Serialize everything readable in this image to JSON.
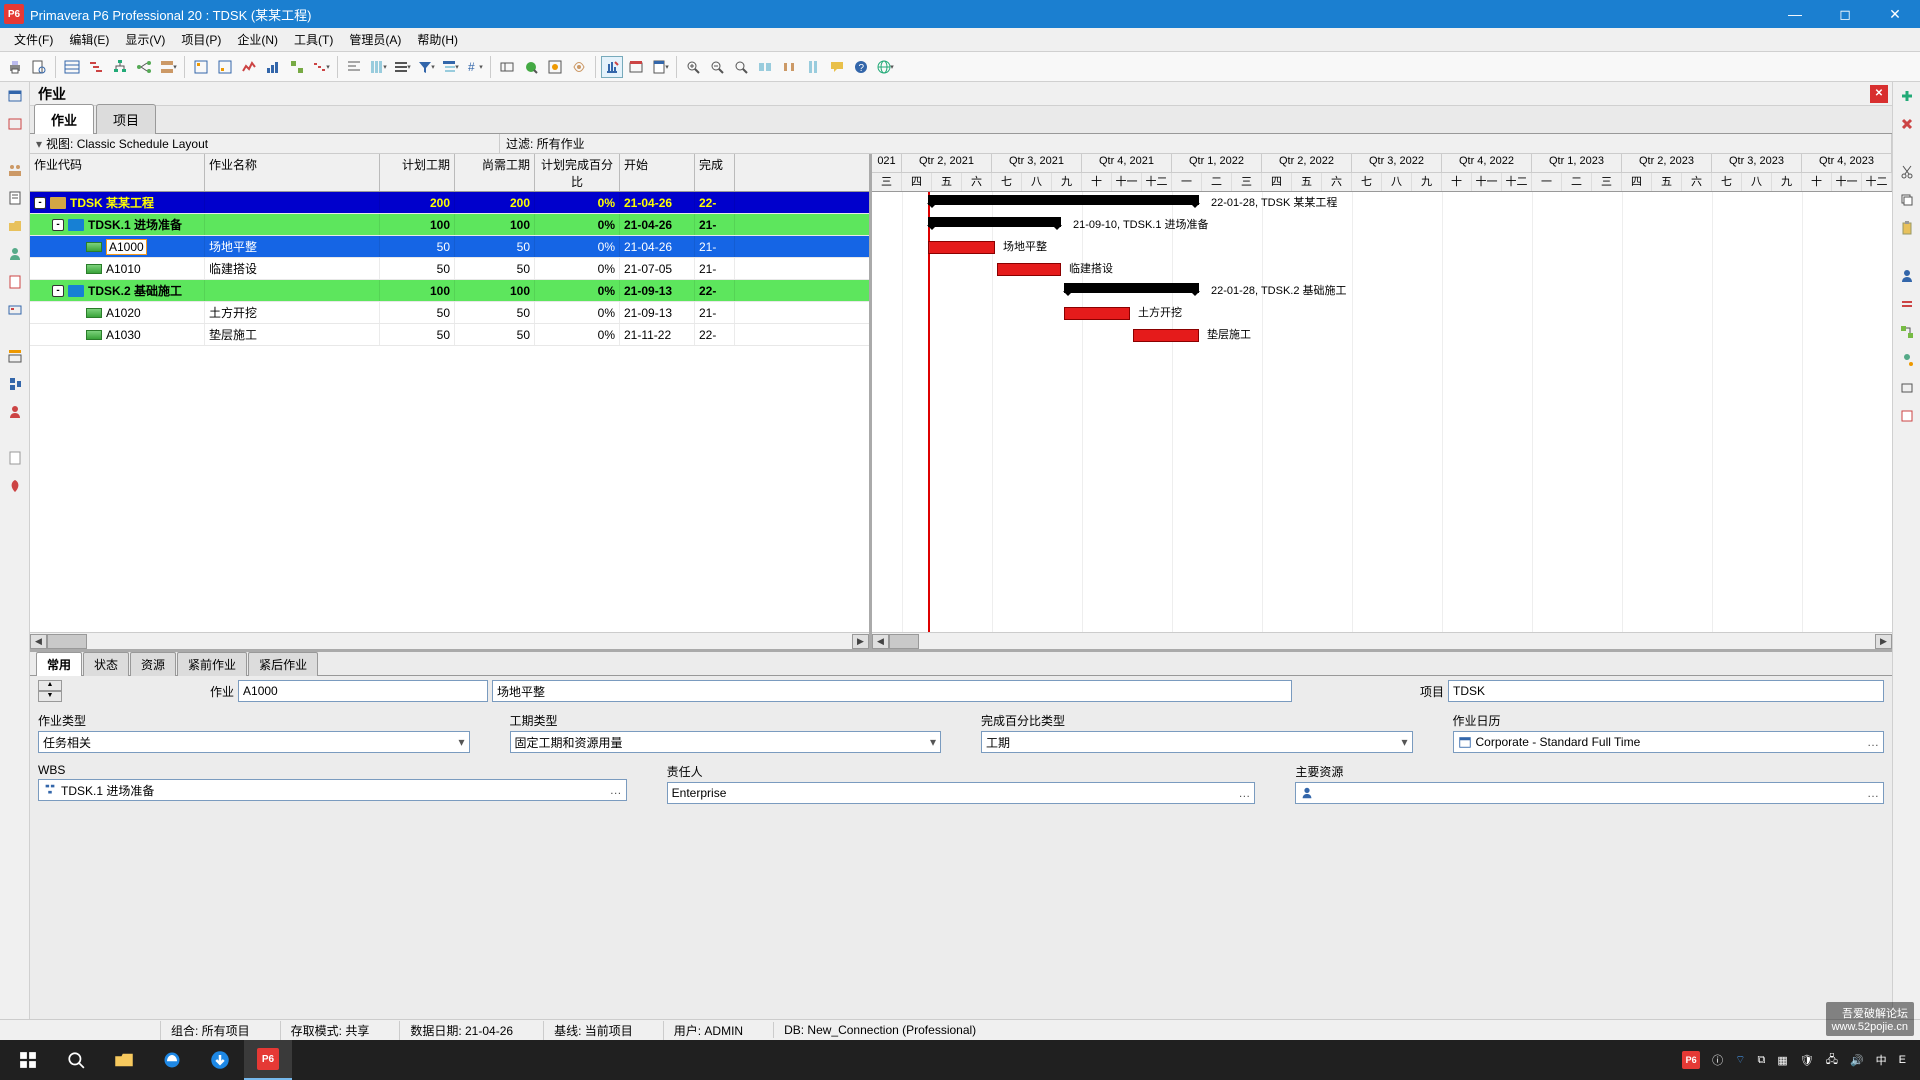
{
  "title": "Primavera P6 Professional 20 : TDSK (某某工程)",
  "menus": [
    "文件(F)",
    "编辑(E)",
    "显示(V)",
    "项目(P)",
    "企业(N)",
    "工具(T)",
    "管理员(A)",
    "帮助(H)"
  ],
  "section_title": "作业",
  "view_tabs": [
    "作业",
    "项目"
  ],
  "layout_label": "视图: Classic Schedule Layout",
  "filter_label": "过滤: 所有作业",
  "grid_headers": {
    "id": "作业代码",
    "name": "作业名称",
    "d1": "计划工期",
    "d2": "尚需工期",
    "pct": "计划完成百分比",
    "start": "开始",
    "end": "完成"
  },
  "rows": [
    {
      "lvl": 0,
      "id": "TDSK  某某工程",
      "name": "",
      "d1": "200",
      "d2": "200",
      "pct": "0%",
      "start": "21-04-26",
      "end": "22-"
    },
    {
      "lvl": 1,
      "id": "TDSK.1  进场准备",
      "name": "",
      "d1": "100",
      "d2": "100",
      "pct": "0%",
      "start": "21-04-26",
      "end": "21-"
    },
    {
      "lvl": 2,
      "sel": true,
      "id": "A1000",
      "name": "场地平整",
      "d1": "50",
      "d2": "50",
      "pct": "0%",
      "start": "21-04-26",
      "end": "21-"
    },
    {
      "lvl": 2,
      "id": "A1010",
      "name": "临建搭设",
      "d1": "50",
      "d2": "50",
      "pct": "0%",
      "start": "21-07-05",
      "end": "21-"
    },
    {
      "lvl": 1,
      "id": "TDSK.2  基础施工",
      "name": "",
      "d1": "100",
      "d2": "100",
      "pct": "0%",
      "start": "21-09-13",
      "end": "22-"
    },
    {
      "lvl": 2,
      "id": "A1020",
      "name": "土方开挖",
      "d1": "50",
      "d2": "50",
      "pct": "0%",
      "start": "21-09-13",
      "end": "21-"
    },
    {
      "lvl": 2,
      "id": "A1030",
      "name": "垫层施工",
      "d1": "50",
      "d2": "50",
      "pct": "0%",
      "start": "21-11-22",
      "end": "22-"
    }
  ],
  "quarters": [
    "021",
    "Qtr 2, 2021",
    "Qtr 3, 2021",
    "Qtr 4, 2021",
    "Qtr 1, 2022",
    "Qtr 2, 2022",
    "Qtr 3, 2022",
    "Qtr 4, 2022",
    "Qtr 1, 2023",
    "Qtr 2, 2023",
    "Qtr 3, 2023",
    "Qtr 4, 2023"
  ],
  "months": [
    "三",
    "四",
    "五",
    "六",
    "七",
    "八",
    "九",
    "十",
    "十一",
    "十二",
    "一",
    "二",
    "三",
    "四",
    "五",
    "六",
    "七",
    "八",
    "九",
    "十",
    "十一",
    "十二",
    "一",
    "二",
    "三",
    "四",
    "五",
    "六",
    "七",
    "八",
    "九",
    "十",
    "十一",
    "十二"
  ],
  "gantt_labels": {
    "proj": "22-01-28, TDSK  某某工程",
    "wbs1": "21-09-10, TDSK.1  进场准备",
    "a1000": "场地平整",
    "a1010": "临建搭设",
    "wbs2": "22-01-28, TDSK.2  基础施工",
    "a1020": "土方开挖",
    "a1030": "垫层施工"
  },
  "detail_tabs": [
    "常用",
    "状态",
    "资源",
    "紧前作业",
    "紧后作业"
  ],
  "form": {
    "activity_label": "作业",
    "activity_id": "A1000",
    "activity_name": "场地平整",
    "project_label": "项目",
    "project_id": "TDSK",
    "type_label": "作业类型",
    "type_value": "任务相关",
    "dur_label": "工期类型",
    "dur_value": "固定工期和资源用量",
    "pct_label": "完成百分比类型",
    "pct_value": "工期",
    "cal_label": "作业日历",
    "cal_value": "Corporate - Standard Full Time",
    "wbs_label": "WBS",
    "wbs_value": "TDSK.1  进场准备",
    "owner_label": "责任人",
    "owner_value": "Enterprise",
    "res_label": "主要资源",
    "res_value": ""
  },
  "status": {
    "portfolio": "组合: 所有项目",
    "access": "存取模式: 共享",
    "datadate": "数据日期: 21-04-26",
    "baseline": "基线: 当前项目",
    "user": "用户: ADMIN",
    "db": "DB: New_Connection (Professional)"
  },
  "watermark": {
    "l1": "吾爱破解论坛",
    "l2": "www.52pojie.cn"
  }
}
